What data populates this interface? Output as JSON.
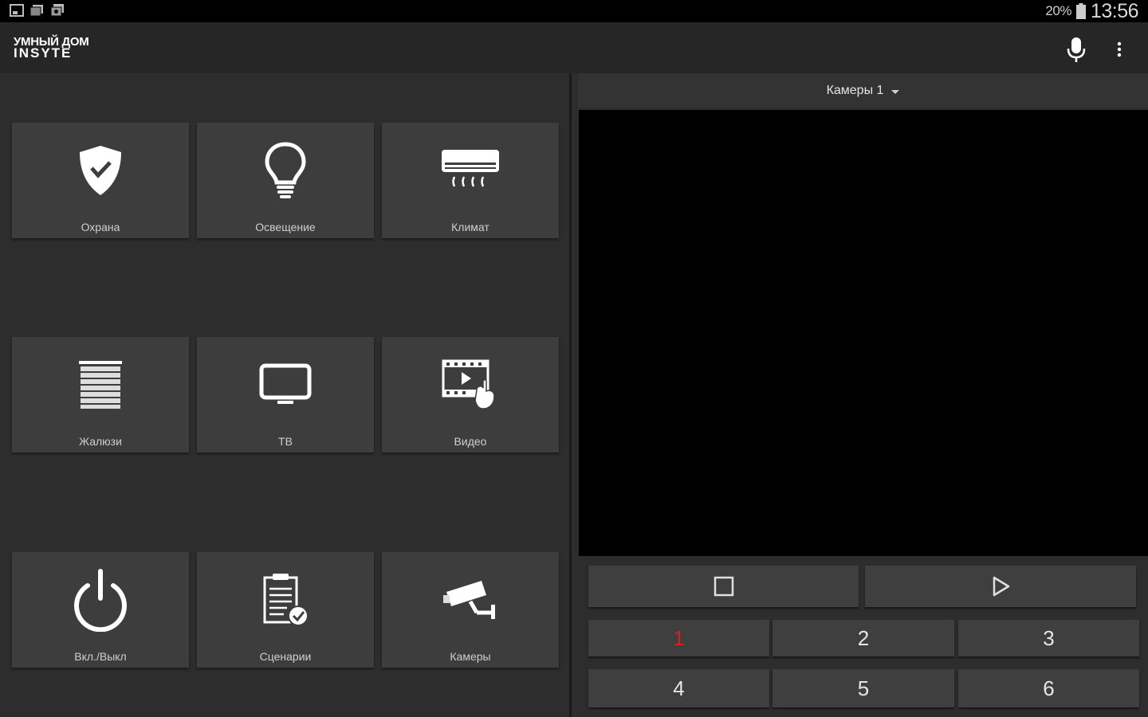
{
  "status_bar": {
    "icons": [
      "gallery-icon",
      "screenshot-icon",
      "camera-icon"
    ],
    "battery_percent": "20%",
    "time": "13:56"
  },
  "app_bar": {
    "logo_line1": "УМНЫЙ ДОМ",
    "logo_line2": "INSYTE",
    "mic_icon": "microphone-icon",
    "menu_icon": "overflow-menu-icon"
  },
  "tiles": [
    {
      "label": "Охрана",
      "icon": "shield-icon"
    },
    {
      "label": "Освещение",
      "icon": "lightbulb-icon"
    },
    {
      "label": "Климат",
      "icon": "air-conditioner-icon"
    },
    {
      "label": "Жалюзи",
      "icon": "blinds-icon"
    },
    {
      "label": "ТВ",
      "icon": "tv-icon"
    },
    {
      "label": "Видео",
      "icon": "video-icon"
    },
    {
      "label": "Вкл./Выкл",
      "icon": "power-icon"
    },
    {
      "label": "Сценарии",
      "icon": "scenarios-icon"
    },
    {
      "label": "Камеры",
      "icon": "security-camera-icon"
    }
  ],
  "camera_panel": {
    "selected_camera": "Камеры 1",
    "controls": {
      "stop_icon": "stop-icon",
      "play_icon": "play-icon"
    },
    "channels": [
      "1",
      "2",
      "3",
      "4",
      "5",
      "6"
    ],
    "active_channel": "1"
  },
  "colors": {
    "background": "#2d2d2d",
    "tile": "#3d3d3d",
    "accent_active": "#d52020"
  }
}
